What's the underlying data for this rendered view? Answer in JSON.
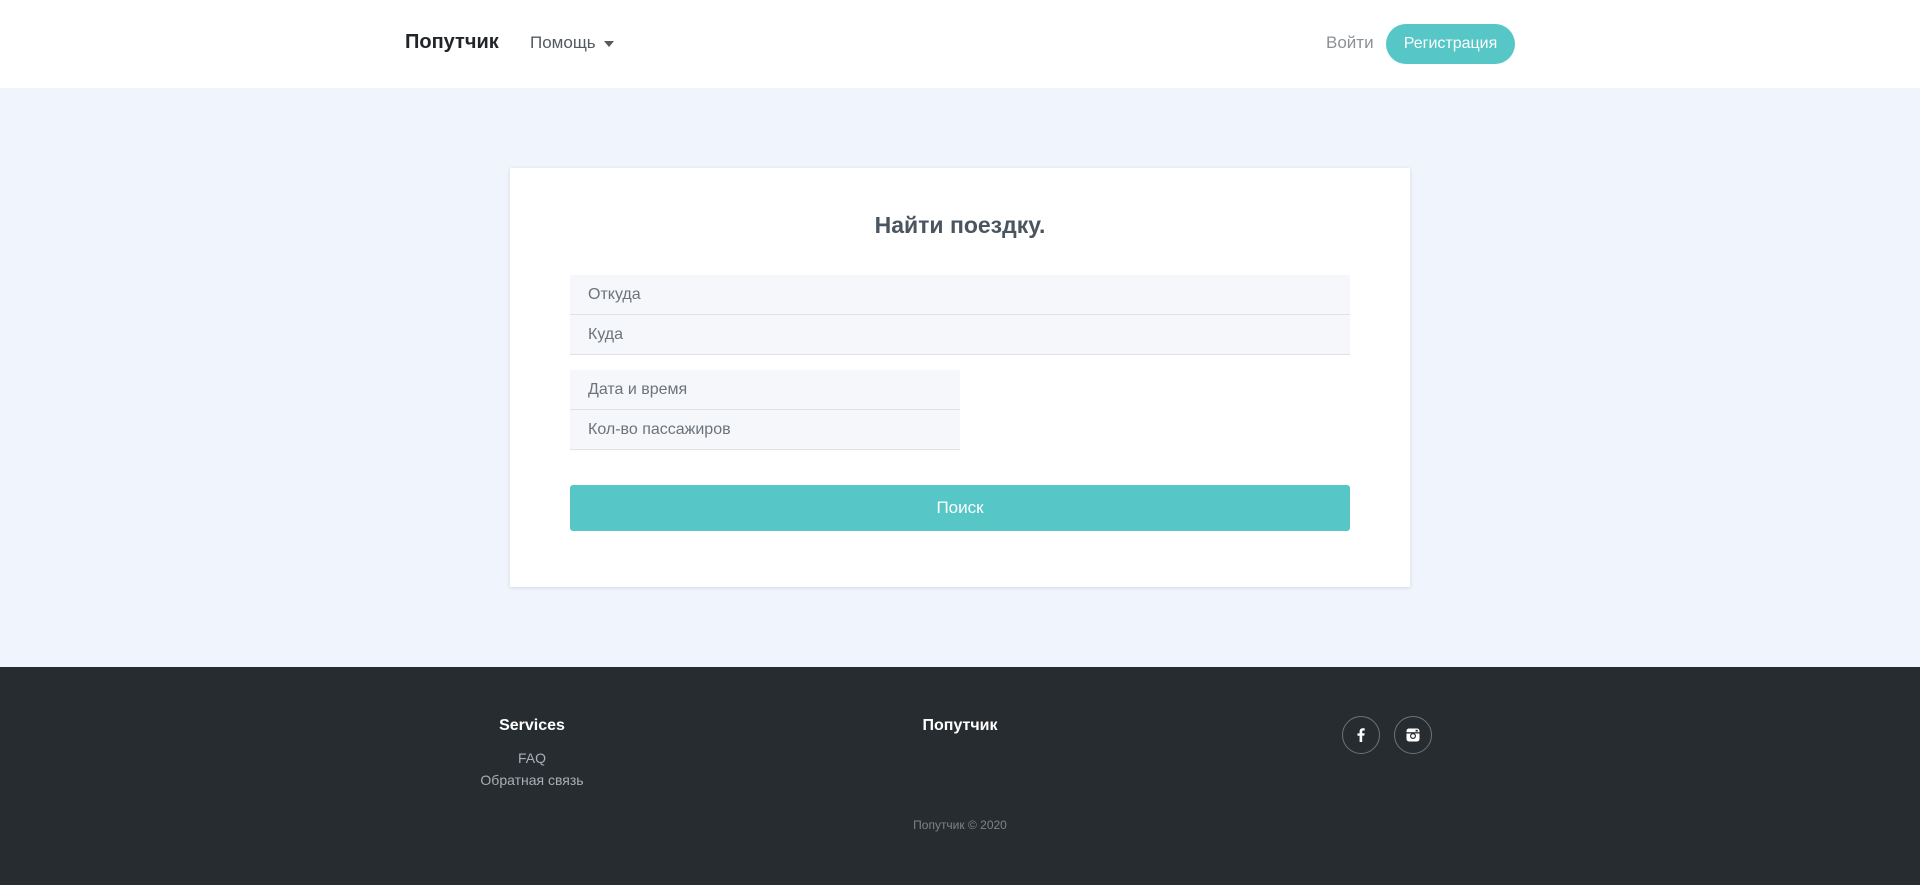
{
  "header": {
    "brand": "Попутчик",
    "help_label": "Помощь",
    "login_label": "Войти",
    "register_label": "Регистрация"
  },
  "search_form": {
    "title": "Найти поездку.",
    "from_placeholder": "Откуда",
    "to_placeholder": "Куда",
    "datetime_placeholder": "Дата и время",
    "passengers_placeholder": "Кол-во пассажиров",
    "submit_label": "Поиск"
  },
  "footer": {
    "services_title": "Services",
    "services_links": [
      "FAQ",
      "Обратная связь"
    ],
    "brand_title": "Попутчик",
    "social_icons": [
      "facebook-icon",
      "instagram-icon"
    ],
    "copyright": "Попутчик © 2020"
  },
  "colors": {
    "accent": "#56c6c6",
    "page_background": "#f0f5fd",
    "footer_background": "#272c30"
  }
}
